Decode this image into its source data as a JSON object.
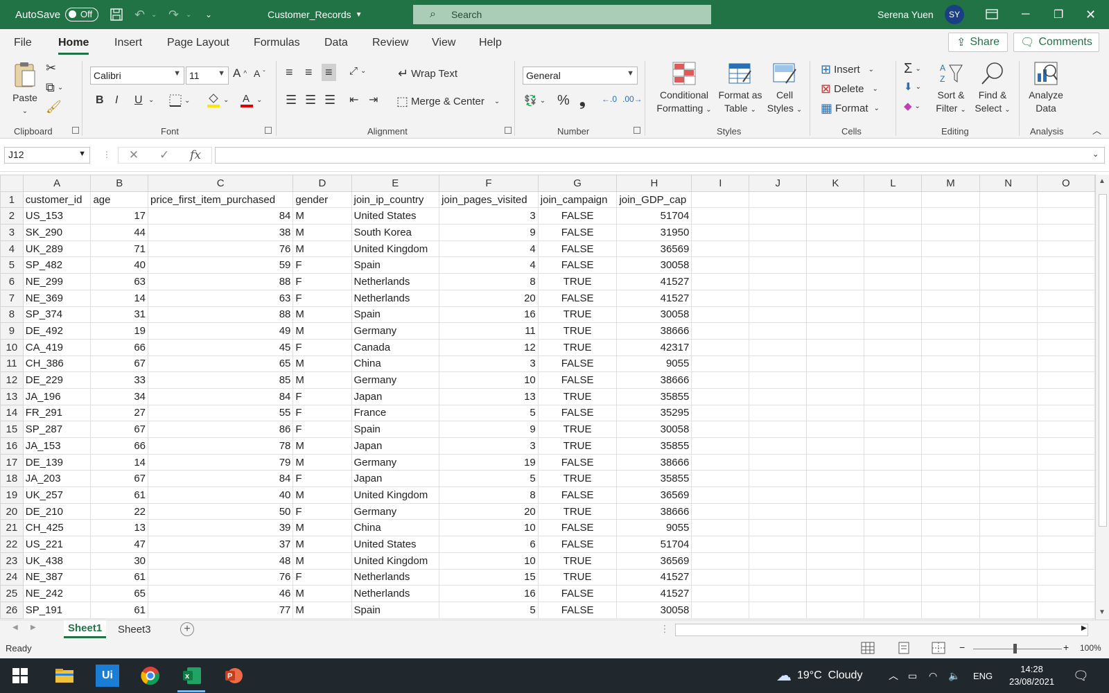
{
  "titlebar": {
    "autosave_label": "AutoSave",
    "autosave_state": "Off",
    "document_title": "Customer_Records",
    "search_placeholder": "Search",
    "user_name": "Serena Yuen",
    "user_initials": "SY"
  },
  "menu": {
    "tabs": [
      "File",
      "Home",
      "Insert",
      "Page Layout",
      "Formulas",
      "Data",
      "Review",
      "View",
      "Help"
    ],
    "active": "Home",
    "share_label": "Share",
    "comments_label": "Comments"
  },
  "ribbon": {
    "clipboard": {
      "paste": "Paste",
      "group": "Clipboard"
    },
    "font": {
      "name": "Calibri",
      "size": "11",
      "bold": "B",
      "italic": "I",
      "underline": "U",
      "group": "Font"
    },
    "alignment": {
      "wrap_text": "Wrap Text",
      "merge_center": "Merge & Center",
      "group": "Alignment"
    },
    "number": {
      "format": "General",
      "percent": "%",
      "comma": "❟",
      "group": "Number"
    },
    "styles": {
      "conditional": "Conditional",
      "formatting": "Formatting",
      "format_as": "Format as",
      "table": "Table",
      "cell": "Cell",
      "styles": "Styles",
      "group": "Styles"
    },
    "cells": {
      "insert": "Insert",
      "delete": "Delete",
      "format": "Format",
      "group": "Cells"
    },
    "editing": {
      "sort": "Sort &",
      "filter": "Filter",
      "find": "Find &",
      "select": "Select",
      "group": "Editing"
    },
    "analysis": {
      "analyze": "Analyze",
      "data": "Data",
      "group": "Analysis"
    }
  },
  "formula_bar": {
    "name_box": "J12",
    "fx": "fx",
    "content": ""
  },
  "sheet": {
    "columns": [
      "A",
      "B",
      "C",
      "D",
      "E",
      "F",
      "G",
      "H",
      "I",
      "J",
      "K",
      "L",
      "M",
      "N",
      "O"
    ],
    "headers": [
      "customer_id",
      "age",
      "price_first_item_purchased",
      "gender",
      "join_ip_country",
      "join_pages_visited",
      "join_campaign",
      "join_GDP_cap"
    ],
    "rows": [
      [
        "US_153",
        "17",
        "84",
        "M",
        "United States",
        "3",
        "FALSE",
        "51704"
      ],
      [
        "SK_290",
        "44",
        "38",
        "M",
        "South Korea",
        "9",
        "FALSE",
        "31950"
      ],
      [
        "UK_289",
        "71",
        "76",
        "M",
        "United Kingdom",
        "4",
        "FALSE",
        "36569"
      ],
      [
        "SP_482",
        "40",
        "59",
        "F",
        "Spain",
        "4",
        "FALSE",
        "30058"
      ],
      [
        "NE_299",
        "63",
        "88",
        "F",
        "Netherlands",
        "8",
        "TRUE",
        "41527"
      ],
      [
        "NE_369",
        "14",
        "63",
        "F",
        "Netherlands",
        "20",
        "FALSE",
        "41527"
      ],
      [
        "SP_374",
        "31",
        "88",
        "M",
        "Spain",
        "16",
        "TRUE",
        "30058"
      ],
      [
        "DE_492",
        "19",
        "49",
        "M",
        "Germany",
        "11",
        "TRUE",
        "38666"
      ],
      [
        "CA_419",
        "66",
        "45",
        "F",
        "Canada",
        "12",
        "TRUE",
        "42317"
      ],
      [
        "CH_386",
        "67",
        "65",
        "M",
        "China",
        "3",
        "FALSE",
        "9055"
      ],
      [
        "DE_229",
        "33",
        "85",
        "M",
        "Germany",
        "10",
        "FALSE",
        "38666"
      ],
      [
        "JA_196",
        "34",
        "84",
        "F",
        "Japan",
        "13",
        "TRUE",
        "35855"
      ],
      [
        "FR_291",
        "27",
        "55",
        "F",
        "France",
        "5",
        "FALSE",
        "35295"
      ],
      [
        "SP_287",
        "67",
        "86",
        "F",
        "Spain",
        "9",
        "TRUE",
        "30058"
      ],
      [
        "JA_153",
        "66",
        "78",
        "M",
        "Japan",
        "3",
        "TRUE",
        "35855"
      ],
      [
        "DE_139",
        "14",
        "79",
        "M",
        "Germany",
        "19",
        "FALSE",
        "38666"
      ],
      [
        "JA_203",
        "67",
        "84",
        "F",
        "Japan",
        "5",
        "TRUE",
        "35855"
      ],
      [
        "UK_257",
        "61",
        "40",
        "M",
        "United Kingdom",
        "8",
        "FALSE",
        "36569"
      ],
      [
        "DE_210",
        "22",
        "50",
        "F",
        "Germany",
        "20",
        "TRUE",
        "38666"
      ],
      [
        "CH_425",
        "13",
        "39",
        "M",
        "China",
        "10",
        "FALSE",
        "9055"
      ],
      [
        "US_221",
        "47",
        "37",
        "M",
        "United States",
        "6",
        "FALSE",
        "51704"
      ],
      [
        "UK_438",
        "30",
        "48",
        "M",
        "United Kingdom",
        "10",
        "TRUE",
        "36569"
      ],
      [
        "NE_387",
        "61",
        "76",
        "F",
        "Netherlands",
        "15",
        "TRUE",
        "41527"
      ],
      [
        "NE_242",
        "65",
        "46",
        "M",
        "Netherlands",
        "16",
        "FALSE",
        "41527"
      ],
      [
        "SP_191",
        "61",
        "77",
        "M",
        "Spain",
        "5",
        "FALSE",
        "30058"
      ]
    ],
    "tabs": [
      "Sheet1",
      "Sheet3"
    ],
    "active_tab": "Sheet1"
  },
  "status": {
    "state": "Ready",
    "zoom": "100%"
  },
  "taskbar": {
    "weather": "19°C  Cloudy",
    "language": "ENG",
    "time": "14:28",
    "date": "23/08/2021"
  },
  "colors": {
    "excel_green": "#217346",
    "ribbon_bg": "#f3f3f3",
    "taskbar_bg": "#20282e"
  }
}
